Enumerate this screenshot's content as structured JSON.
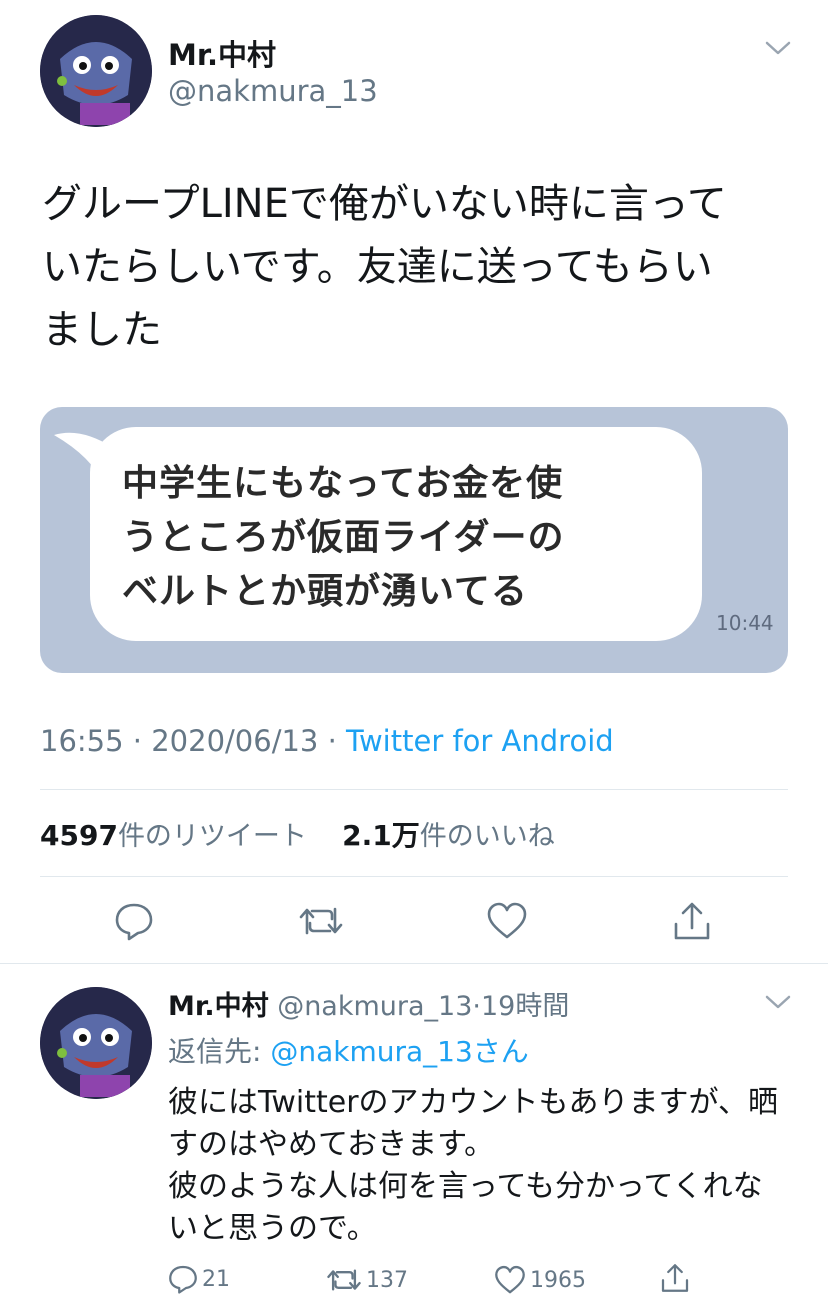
{
  "tweet": {
    "display_name": "Mr.中村",
    "handle": "@nakmura_13",
    "text_lines": [
      "グループLINEで俺がいない時に言って",
      "いたらしいです。友達に送ってもらい",
      "ました"
    ],
    "media": {
      "bubble_lines": [
        "中学生にもなってお金を使",
        "うところが仮面ライダーの",
        "ベルトとか頭が湧いてる"
      ],
      "time": "10:44"
    },
    "meta": {
      "time": "16:55",
      "date": "2020/06/13",
      "separator": "·",
      "source": "Twitter for Android"
    },
    "stats": {
      "retweets_count": "4597",
      "retweets_label": "件のリツイート",
      "likes_count": "2.1万",
      "likes_label": "件のいいね"
    },
    "actions": [
      "reply-icon",
      "retweet-icon",
      "like-icon",
      "share-icon"
    ]
  },
  "reply": {
    "display_name": "Mr.中村",
    "handle": "@nakmura_13",
    "separator": "·",
    "age": "19時間",
    "replying_to_label": "返信先:",
    "replying_to_user": "@nakmura_13さん",
    "text_lines": [
      "彼にはTwitterのアカウントもありますが、晒",
      "すのはやめておきます。",
      "彼のような人は何を言っても分かってくれな",
      "いと思うので。"
    ],
    "counts": {
      "replies": "21",
      "retweets": "137",
      "likes": "1965"
    }
  },
  "colors": {
    "accent": "#1da1f2",
    "secondary_text": "#657786",
    "divider": "#e1e8ed",
    "media_bg": "#b7c4d8"
  }
}
